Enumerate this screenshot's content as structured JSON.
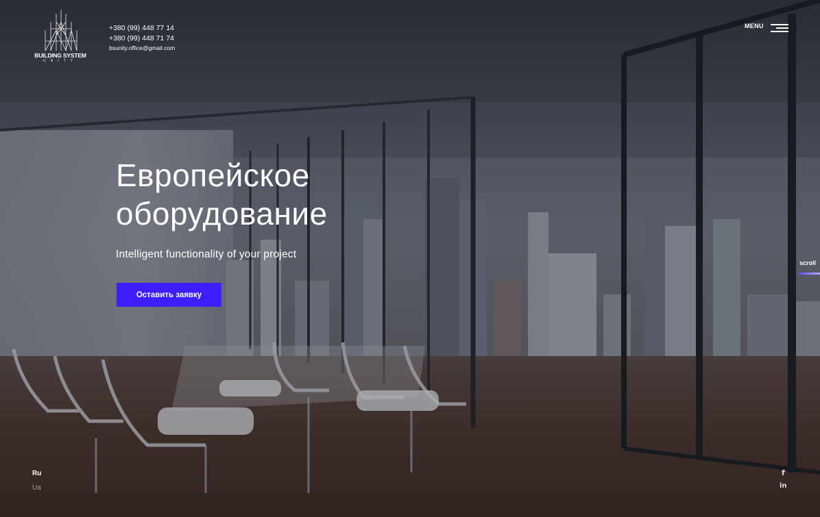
{
  "logo": {
    "title": "BUILDING SYSTEM",
    "subtitle": "UNITY"
  },
  "contacts": {
    "phone_1": "+380 (99) 448 77 14",
    "phone_2": "+380 (99) 448 71 74",
    "email": "bsunity.office@gmail.com"
  },
  "header": {
    "menu_label": "MENU",
    "menu_icon": "hamburger-icon"
  },
  "hero": {
    "title_line_1": "Европейское",
    "title_line_2": "оборудование",
    "subtitle": "Intelligent functionality of your project",
    "cta_label": "Оставить заявку",
    "background": "office-meeting-room-city-view-photo"
  },
  "scroll": {
    "label": "scroll"
  },
  "languages": {
    "active": "Ru",
    "other": "Ua"
  },
  "social": {
    "facebook": "f",
    "linkedin": "in"
  },
  "colors": {
    "accent": "#3e1dff",
    "text": "#ffffff"
  }
}
